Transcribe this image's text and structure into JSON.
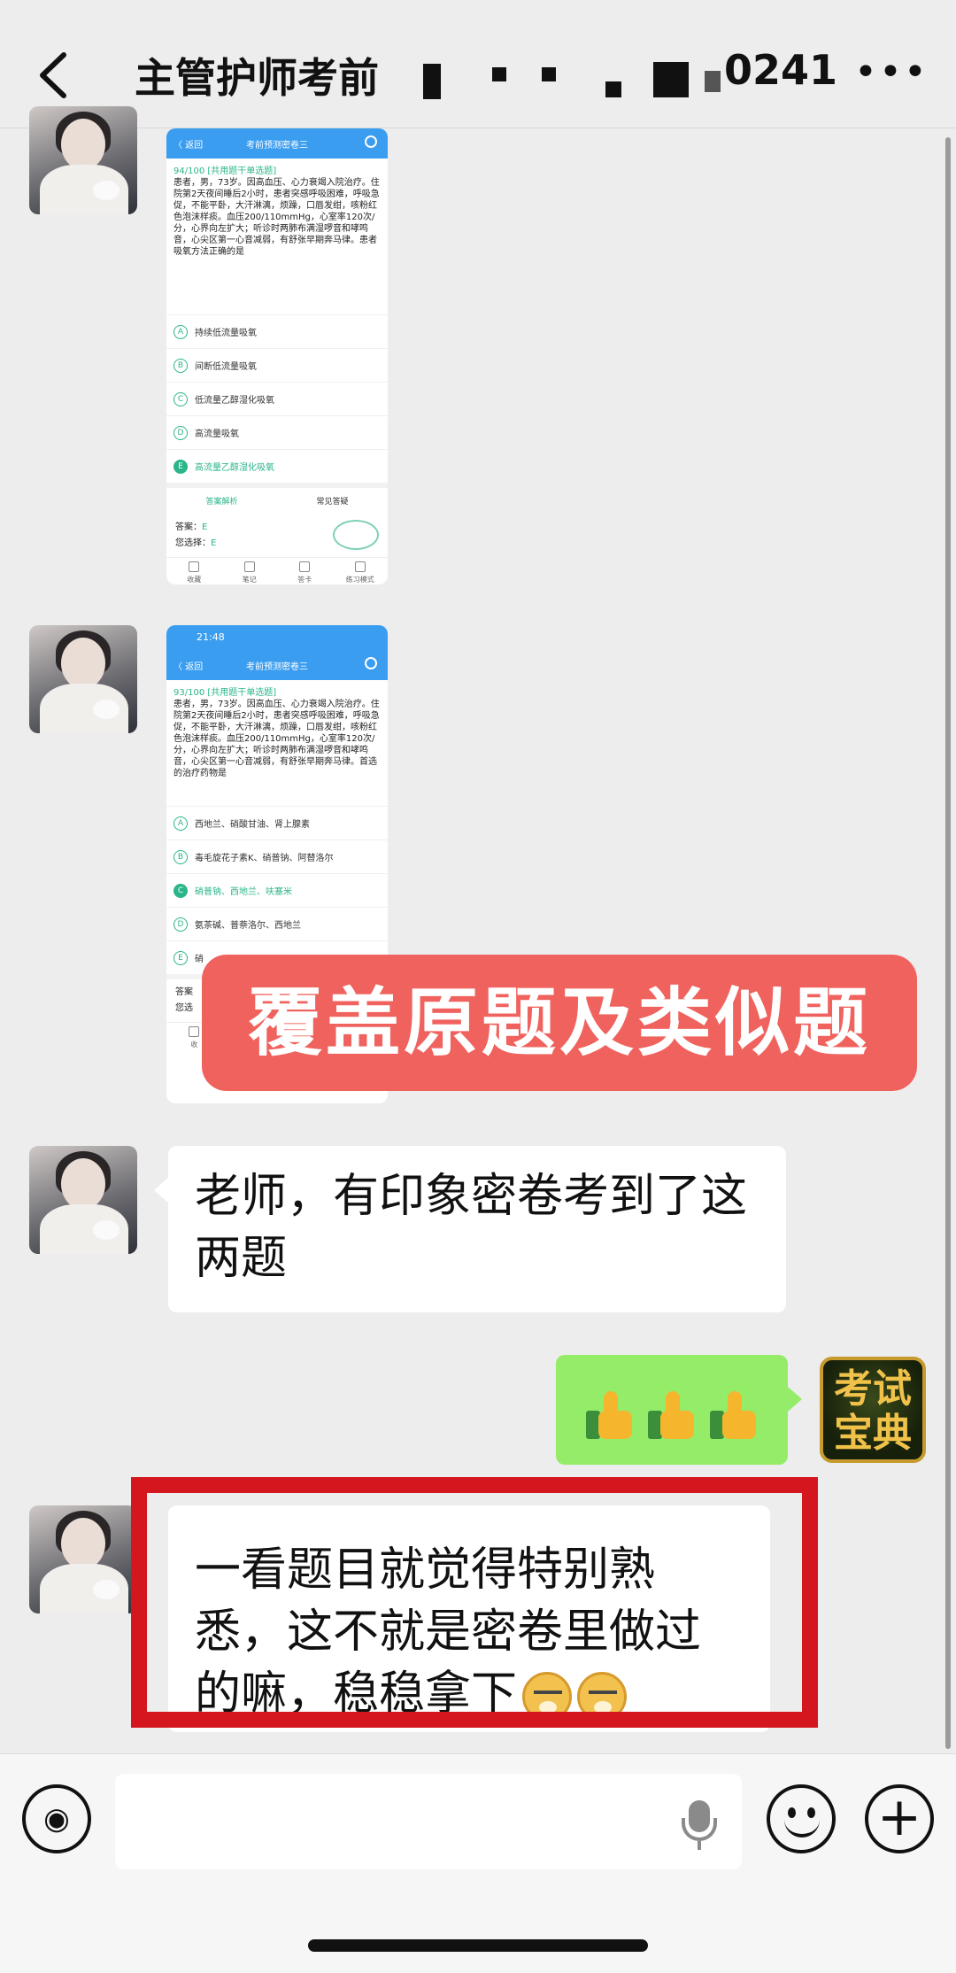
{
  "header": {
    "back_icon": "chevron-left-icon",
    "title": "主管护师考前",
    "title_suffix": "0241",
    "more_icon": "ellipsis-icon",
    "more_label": "•••"
  },
  "messages": {
    "shot1": {
      "nav_back": "〈 返回",
      "nav_title": "考前预测密卷三",
      "qnum": "94/100",
      "qtype": "[共用题干单选题]",
      "stem": "患者，男，73岁。因高血压、心力衰竭入院治疗。住院第2天夜间睡后2小时，患者突感呼吸困难，呼吸急促，不能平卧，大汗淋漓，烦躁，口唇发绀，咳粉红色泡沫样痰。血压200/110mmHg，心室率120次/分，心界向左扩大；听诊时两肺布满湿啰音和哮鸣音，心尖区第一心音减弱，有舒张早期奔马律。患者吸氧方法正确的是",
      "options": [
        {
          "key": "A",
          "text": "持续低流量吸氧"
        },
        {
          "key": "B",
          "text": "间断低流量吸氧"
        },
        {
          "key": "C",
          "text": "低流量乙醇湿化吸氧"
        },
        {
          "key": "D",
          "text": "高流量吸氧"
        },
        {
          "key": "E",
          "text": "高流量乙醇湿化吸氧"
        }
      ],
      "tab_active": "答案解析",
      "tab_other": "常见答疑",
      "answer_label": "答案：",
      "answer_value": "E",
      "chosen_label": "您选择：",
      "chosen_value": "E",
      "toolbar": [
        "收藏",
        "笔记",
        "答卡",
        "练习模式"
      ]
    },
    "shot2": {
      "status_time": "21:48",
      "nav_back": "〈 返回",
      "nav_title": "考前预测密卷三",
      "qnum": "93/100",
      "qtype": "[共用题干单选题]",
      "stem": "患者，男，73岁。因高血压、心力衰竭入院治疗。住院第2天夜间睡后2小时，患者突感呼吸困难，呼吸急促，不能平卧，大汗淋漓，烦躁，口唇发绀，咳粉红色泡沫样痰。血压200/110mmHg，心室率120次/分，心界向左扩大；听诊时两肺布满湿啰音和哮鸣音，心尖区第一心音减弱，有舒张早期奔马律。首选的治疗药物是",
      "options": [
        {
          "key": "A",
          "text": "西地兰、硝酸甘油、肾上腺素"
        },
        {
          "key": "B",
          "text": "毒毛旋花子素K、硝普钠、阿替洛尔"
        },
        {
          "key": "C",
          "text": "硝普钠、西地兰、呋塞米"
        },
        {
          "key": "D",
          "text": "氨茶碱、普萘洛尔、西地兰"
        },
        {
          "key": "E",
          "text": "硝"
        }
      ],
      "answer_label": "答案",
      "chosen_label": "您选",
      "toolbar_first": "收"
    },
    "banner": "覆盖原题及类似题",
    "msg1": "老师，有印象密卷考到了这两题",
    "reply_icons": [
      "thumbs-up-icon",
      "thumbs-up-icon",
      "thumbs-up-icon"
    ],
    "reply_avatar": "考试宝典",
    "msg2": "一看题目就觉得特别熟悉，这不就是密卷里做过的嘛，稳稳拿下",
    "msg2_icons": [
      "doge-emoji-icon",
      "doge-emoji-icon"
    ]
  },
  "input_bar": {
    "voice_icon": "voice-icon",
    "mic_icon": "microphone-icon",
    "emoji_icon": "smiley-icon",
    "plus_icon": "plus-icon",
    "voice_glyph": "◉",
    "plus_glyph": "+"
  }
}
